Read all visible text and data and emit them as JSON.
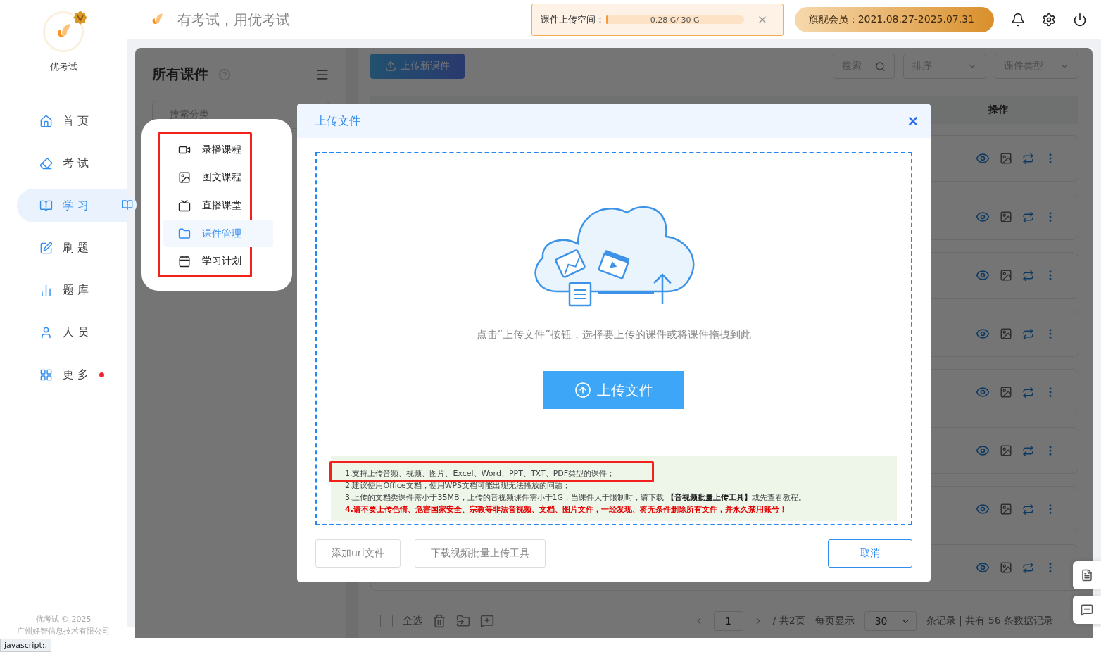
{
  "sidebar": {
    "brand": "优考试",
    "items": [
      {
        "label": "首页",
        "selected": false,
        "badge": false
      },
      {
        "label": "考试",
        "selected": false,
        "badge": false
      },
      {
        "label": "学习",
        "selected": true,
        "badge": false
      },
      {
        "label": "刷题",
        "selected": false,
        "badge": false
      },
      {
        "label": "题库",
        "selected": false,
        "badge": false
      },
      {
        "label": "人员",
        "selected": false,
        "badge": false
      },
      {
        "label": "更多",
        "selected": false,
        "badge": true
      }
    ],
    "footer": [
      "优考试 © 2025",
      "广州好智信息技术有限公司"
    ]
  },
  "topbar": {
    "slogan": "有考试，用优考试",
    "storage": {
      "label": "课件上传空间：",
      "level": 0.01,
      "reading": "0.28 G/ 30 G"
    },
    "membership": "旗舰会员：2021.08.27-2025.07.31"
  },
  "panel": {
    "title": "所有课件",
    "category_search": {
      "placeholder": "搜索分类"
    },
    "upload_button": "上传新课件",
    "search": {
      "placeholder": "搜索"
    },
    "sort": {
      "placeholder": "排序"
    },
    "type_filter": {
      "placeholder": "课件类型"
    },
    "table": {
      "column_label": "操作"
    },
    "footer": {
      "select_all_checked": false,
      "select_all": "全选",
      "page": "1",
      "pages": "/ 共2页",
      "per_page_label": "每页显示",
      "per_page": "30",
      "total": "条记录 | 共有 56 条数据记录"
    }
  },
  "submenu": {
    "items": [
      {
        "label": "录播课程",
        "selected": false
      },
      {
        "label": "图文课程",
        "selected": false
      },
      {
        "label": "直播课堂",
        "selected": false
      },
      {
        "label": "课件管理",
        "selected": true
      },
      {
        "label": "学习计划",
        "selected": false
      }
    ]
  },
  "dialog": {
    "title": "上传文件",
    "hint": "点击“上传文件”按钮，选择要上传的课件或将课件拖拽到此",
    "upload_button": "上传文件",
    "notes": [
      {
        "kind": "normal",
        "text": "1.支持上传音频、视频、图片、Excel、Word、PPT、TXT、PDF类型的课件；"
      },
      {
        "kind": "normal",
        "text": "2.建议使用Office文档，使用WPS文档可能出现无法播放的问题；"
      },
      {
        "kind": "normal",
        "text": "3.上传的文档类课件需小于35MB，上传的音视频课件需小于1G，当课件大于限制时，请下载 **【音视频批量上传工具】**或先查看教程。"
      },
      {
        "kind": "warning",
        "text": "4.请不要上传色情、危害国家安全、宗教等非法音视频、文档、图片文件，一经发现、将无条件删除所有文件，并永久禁用账号！"
      }
    ],
    "buttons": [
      "添加url文件",
      "下载视频批量上传工具"
    ],
    "cancel": "取消"
  },
  "status_bar": "javascript:;"
}
